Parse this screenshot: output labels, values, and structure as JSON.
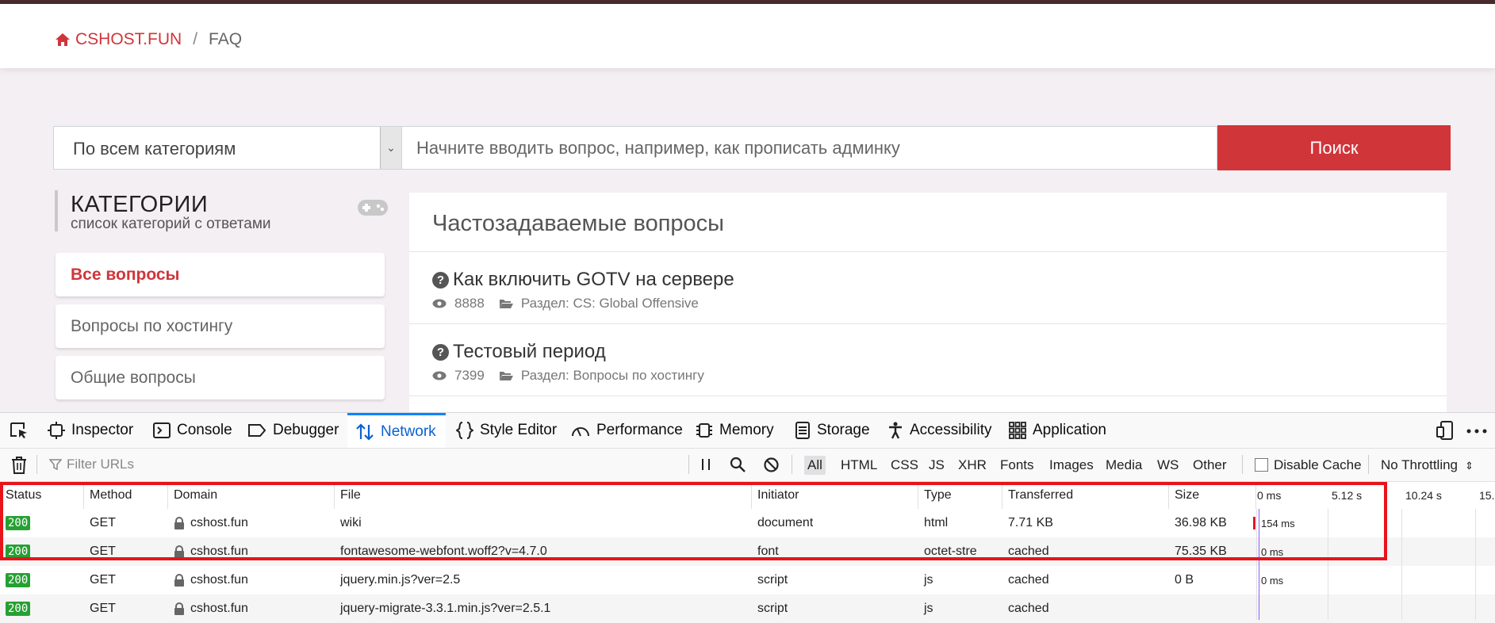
{
  "breadcrumb": {
    "home": "CSHOST.FUN",
    "separator": "/",
    "current": "FAQ"
  },
  "search": {
    "category_value": "По всем категориям",
    "placeholder": "Начните вводить вопрос, например, как прописать админку",
    "button": "Поиск"
  },
  "categories": {
    "title": "КАТЕГОРИИ",
    "subtitle": "список категорий с ответами",
    "items": [
      {
        "label": "Все вопросы"
      },
      {
        "label": "Вопросы по хостингу"
      },
      {
        "label": "Общие вопросы"
      }
    ]
  },
  "faq": {
    "title": "Частозадаваемые вопросы",
    "questions": [
      {
        "title": "Как включить GOTV на сервере",
        "views": "8888",
        "section": "Раздел: CS: Global Offensive"
      },
      {
        "title": "Тестовый период",
        "views": "7399",
        "section": "Раздел: Вопросы по хостингу"
      }
    ]
  },
  "devtools": {
    "tabs": [
      {
        "label": "Inspector",
        "icon": "inspector-icon"
      },
      {
        "label": "Console",
        "icon": "console-icon"
      },
      {
        "label": "Debugger",
        "icon": "debugger-icon"
      },
      {
        "label": "Network",
        "icon": "network-icon"
      },
      {
        "label": "Style Editor",
        "icon": "style-editor-icon"
      },
      {
        "label": "Performance",
        "icon": "performance-icon"
      },
      {
        "label": "Memory",
        "icon": "memory-icon"
      },
      {
        "label": "Storage",
        "icon": "storage-icon"
      },
      {
        "label": "Accessibility",
        "icon": "accessibility-icon"
      },
      {
        "label": "Application",
        "icon": "application-icon"
      }
    ],
    "filter_placeholder": "Filter URLs",
    "type_filters": [
      "All",
      "HTML",
      "CSS",
      "JS",
      "XHR",
      "Fonts",
      "Images",
      "Media",
      "WS",
      "Other"
    ],
    "disable_cache": "Disable Cache",
    "throttling": "No Throttling",
    "columns": [
      "Status",
      "Method",
      "Domain",
      "File",
      "Initiator",
      "Type",
      "Transferred",
      "Size"
    ],
    "timeline_ticks": [
      "0 ms",
      "5.12 s",
      "10.24 s",
      "15."
    ],
    "rows": [
      {
        "status": "200",
        "method": "GET",
        "domain": "cshost.fun",
        "file": "wiki",
        "initiator": "document",
        "type": "html",
        "transferred": "7.71 KB",
        "size": "36.98 KB",
        "timing": "154 ms"
      },
      {
        "status": "200",
        "method": "GET",
        "domain": "cshost.fun",
        "file": "fontawesome-webfont.woff2?v=4.7.0",
        "initiator": "font",
        "type": "octet-stre",
        "transferred": "cached",
        "size": "75.35 KB",
        "timing": "0 ms"
      },
      {
        "status": "200",
        "method": "GET",
        "domain": "cshost.fun",
        "file": "jquery.min.js?ver=2.5",
        "initiator": "script",
        "type": "js",
        "transferred": "cached",
        "size": "0 B",
        "timing": "0 ms"
      },
      {
        "status": "200",
        "method": "GET",
        "domain": "cshost.fun",
        "file": "jquery-migrate-3.3.1.min.js?ver=2.5.1",
        "initiator": "script",
        "type": "js",
        "transferred": "cached",
        "size": "",
        "timing": ""
      }
    ]
  },
  "colors": {
    "accent": "#d0353a",
    "status_ok": "#26a033",
    "network_tab": "#0a60d4",
    "highlight": "#e8141b"
  }
}
